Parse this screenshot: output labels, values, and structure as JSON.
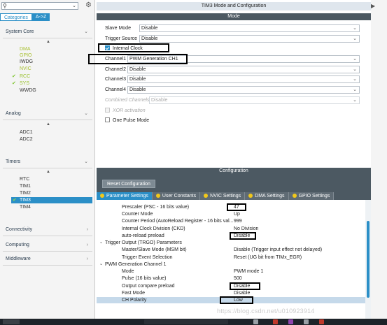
{
  "sidebar": {
    "tabs": {
      "categories": "Categories",
      "az": "A->Z"
    },
    "groups": {
      "system_core": {
        "label": "System Core",
        "items": [
          "DMA",
          "GPIO",
          "IWDG",
          "NVIC",
          "RCC",
          "SYS",
          "WWDG"
        ]
      },
      "analog": {
        "label": "Analog",
        "items": [
          "ADC1",
          "ADC2"
        ]
      },
      "timers": {
        "label": "Timers",
        "items": [
          "RTC",
          "TIM1",
          "TIM2",
          "TIM3",
          "TIM4"
        ]
      },
      "connectivity": {
        "label": "Connectivity"
      },
      "computing": {
        "label": "Computing"
      },
      "middleware": {
        "label": "Middleware"
      }
    },
    "icons": {
      "search": "search-icon",
      "settings": "gear-icon"
    }
  },
  "main": {
    "title": "TIM3 Mode and Configuration",
    "mode_header": "Mode",
    "slave_mode": {
      "label": "Slave Mode",
      "value": "Disable"
    },
    "trigger_source": {
      "label": "Trigger Source",
      "value": "Disable"
    },
    "internal_clock": {
      "label": "Internal Clock",
      "checked": true
    },
    "channel1": {
      "label": "Channel1",
      "value": "PWM Generation CH1"
    },
    "channel2": {
      "label": "Channel2",
      "value": "Disable"
    },
    "channel3": {
      "label": "Channel3",
      "value": "Disable"
    },
    "channel4": {
      "label": "Channel4",
      "value": "Disable"
    },
    "combined_channels": {
      "label": "Combined Channels",
      "value": "Disable"
    },
    "xor_activation": {
      "label": "XOR activation",
      "checked": false
    },
    "one_pulse_mode": {
      "label": "One Pulse Mode",
      "checked": false
    }
  },
  "configuration": {
    "header": "Configuration",
    "reset_button": "Reset Configuration",
    "tabs": [
      "Parameter Settings",
      "User Constants",
      "NVIC Settings",
      "DMA Settings",
      "GPIO Settings"
    ],
    "params": [
      {
        "name": "Prescaler (PSC - 16 bits value)",
        "value": "47"
      },
      {
        "name": "Counter Mode",
        "value": "Up"
      },
      {
        "name": "Counter Period (AutoReload Register - 16 bits val...",
        "value": "999"
      },
      {
        "name": "Internal Clock Division (CKD)",
        "value": "No Division"
      },
      {
        "name": "auto-reload preload",
        "value": "Disable"
      }
    ],
    "sections": {
      "trgo": {
        "label": "Trigger Output (TRGO) Parameters",
        "rows": [
          {
            "name": "Master/Slave Mode (MSM bit)",
            "value": "Disable (Trigger input effect not delayed)"
          },
          {
            "name": "Trigger Event Selection",
            "value": "Reset (UG bit from TIMx_EGR)"
          }
        ]
      },
      "pwm": {
        "label": "PWM Generation Channel 1",
        "rows": [
          {
            "name": "Mode",
            "value": "PWM mode 1"
          },
          {
            "name": "Pulse (16 bits value)",
            "value": "500"
          },
          {
            "name": "Output compare preload",
            "value": "Disable"
          },
          {
            "name": "Fast Mode",
            "value": "Disable"
          },
          {
            "name": "CH Polarity",
            "value": "Low"
          }
        ]
      }
    }
  },
  "watermark": "https://blog.csdn.net/u010923914",
  "colors": {
    "accent": "#2b8fc7",
    "header_dark": "#4c5962",
    "tick_green": "#7cc52a",
    "tab_dot": "#f2c81a"
  }
}
